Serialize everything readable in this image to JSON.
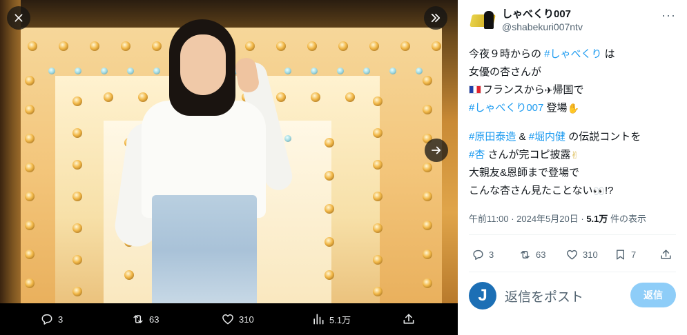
{
  "media_viewer": {
    "close_icon": "close-icon",
    "collapse_icon": "double-chevron-right-icon",
    "next_icon": "arrow-right-icon",
    "actions": {
      "reply_count": "3",
      "retweet_count": "63",
      "like_count": "310",
      "views_count": "5.1万"
    }
  },
  "tweet": {
    "author": {
      "display_name": "しゃべくり007",
      "handle": "@shabekuri007ntv"
    },
    "text": {
      "l1_pre": "今夜９時からの ",
      "l1_tag": "#しゃべくり",
      "l1_post": " は",
      "l2": "女優の杏さんが",
      "l3_a": "フランスから",
      "l3_b": "帰国で",
      "l4_tag": "#しゃべくり007",
      "l4_post": " 登場",
      "l5_tag1": "#原田泰造",
      "l5_mid": " & ",
      "l5_tag2": "#堀内健",
      "l5_post": " の伝説コントを",
      "l6_tag": "#杏",
      "l6_post": " さんが完コピ披露",
      "l7": "大親友&恩師まで登場で",
      "l8_a": "こんな杏さん見たことない",
      "l8_b": "!?"
    },
    "meta": {
      "time": "午前11:00",
      "sep": " · ",
      "date": "2024年5月20日",
      "sep2": " · ",
      "views": "5.1万",
      "views_label": " 件の表示"
    },
    "actions": {
      "reply_count": "3",
      "retweet_count": "63",
      "like_count": "310",
      "bookmark_count": "7"
    },
    "reply": {
      "avatar_letter": "J",
      "placeholder": "返信をポスト",
      "button_label": "返信"
    }
  },
  "colors": {
    "accent": "#1d9bf0",
    "reply_button": "#8ecdf8",
    "secondary_text": "#536471"
  }
}
